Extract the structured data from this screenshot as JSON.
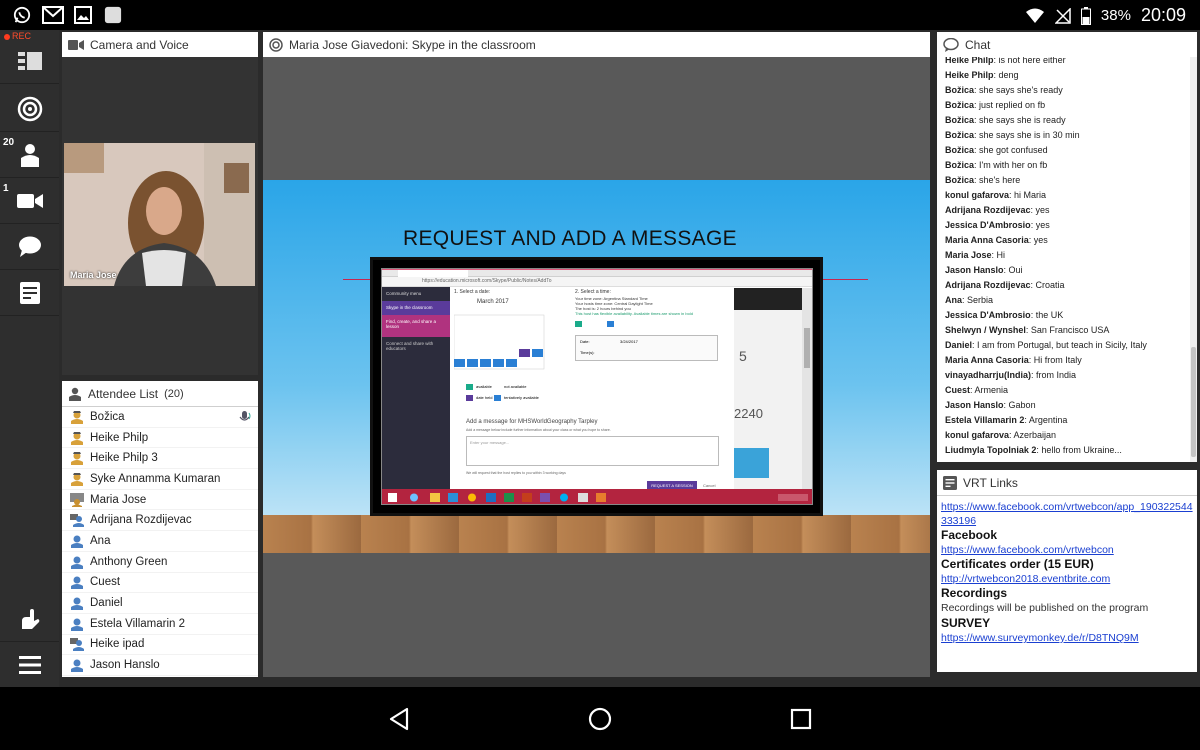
{
  "status_bar": {
    "battery_pct": "38%",
    "time": "20:09",
    "rec_label": "REC"
  },
  "rail": {
    "attendee_count": "20",
    "camera_count": "1"
  },
  "camera_panel": {
    "title": "Camera and Voice",
    "presenter_name": "Maria Jose"
  },
  "attendee_panel": {
    "title": "Attendee List",
    "count": "(20)",
    "attendees": [
      "Božica",
      "Heike  Philp",
      "Heike  Philp 3",
      "Syke Annamma Kumaran",
      "Maria Jose",
      "Adrijana Rozdijevac",
      "Ana",
      "Anthony Green",
      "Cuest",
      "Daniel",
      "Estela Villamarin 2",
      "Heike ipad",
      "Jason Hanslo"
    ]
  },
  "presentation": {
    "title": "Maria Jose Giavedoni: Skype in the classroom",
    "slide_title": "REQUEST AND ADD A MESSAGE",
    "screen": {
      "url": "https://education.microsoft.com/Skype/Public/Notes/AddTo",
      "nav_items": [
        "Community menu",
        "Skype in the classroom",
        "Find, create, and share a lesson",
        "Connect and share with educators"
      ],
      "month": "March 2017",
      "step1": "1. Select a date:",
      "step2": "2. Select a time:",
      "tz1": "Your time zone: Argentina Standard Time",
      "tz2": "Your hosts time zone: Central Daylight Time",
      "host_note": "The host is: 2 hours behind you",
      "avail_note": "This host has flexible availability. Available times are shown in bold",
      "legend_available": "available",
      "legend_not": "not available",
      "legend_tent": "tentatively available",
      "legend_booked": "date held",
      "date_label": "Date:",
      "date_value": "3/24/2017",
      "time_label": "Time(s):",
      "msg_heading": "Add a message for MHSWorldGeography Tarpley",
      "msg_sub": "Add a message below include further information about your class or what you hope to share.",
      "msg_placeholder": "Enter your message...",
      "reply_note": "We will request that the host replies to you within 3 working days",
      "request_btn": "REQUEST A SESSION",
      "cancel": "Cancel",
      "big_number": "5",
      "big_number2": "2240"
    }
  },
  "chat": {
    "title": "Chat",
    "messages": [
      {
        "user": "Heike Philp",
        "text": "is not here either"
      },
      {
        "user": "Heike Philp",
        "text": "deng"
      },
      {
        "user": "Božica",
        "text": "she says she's ready"
      },
      {
        "user": "Božica",
        "text": "just replied on fb"
      },
      {
        "user": "Božica",
        "text": "she says she is ready"
      },
      {
        "user": "Božica",
        "text": "she says she is in 30 min"
      },
      {
        "user": "Božica",
        "text": "she got confused"
      },
      {
        "user": "Božica",
        "text": "I'm with her on fb"
      },
      {
        "user": "Božica",
        "text": "she's here"
      },
      {
        "user": "konul gafarova",
        "text": "hi Maria"
      },
      {
        "user": "Adrijana Rozdijevac",
        "text": "yes"
      },
      {
        "user": "Jessica D'Ambrosio",
        "text": "yes"
      },
      {
        "user": "Maria Anna Casoria",
        "text": "yes"
      },
      {
        "user": "Maria Jose",
        "text": "Hi"
      },
      {
        "user": "Jason Hanslo",
        "text": "Oui"
      },
      {
        "user": "Adrijana Rozdijevac",
        "text": "Croatia"
      },
      {
        "user": "Ana",
        "text": "Serbia"
      },
      {
        "user": "Jessica D'Ambrosio",
        "text": "the UK"
      },
      {
        "user": "Shelwyn / Wynshel",
        "text": "San Francisco USA"
      },
      {
        "user": "Daniel",
        "text": "I am from Portugal, but teach in Sicily, Italy"
      },
      {
        "user": "Maria Anna Casoria",
        "text": "Hi from Italy"
      },
      {
        "user": "vinayadharrju(India)",
        "text": "from India"
      },
      {
        "user": "Cuest",
        "text": "Armenia"
      },
      {
        "user": "Jason Hanslo",
        "text": "Gabon"
      },
      {
        "user": "Estela Villamarin 2",
        "text": "Argentina"
      },
      {
        "user": "konul gafarova",
        "text": "Azerbaijan"
      },
      {
        "user": "Liudmyla Topolniak 2",
        "text": "hello from Ukraine..."
      }
    ]
  },
  "vrt_links": {
    "title": "VRT Links",
    "link1": "https://www.facebook.com/vrtwebcon/app_190322544333196",
    "heading_facebook": "Facebook",
    "link2": "https://www.facebook.com/vrtwebcon",
    "heading_certs": "Certificates order (15 EUR)",
    "link3": "http://vrtwebcon2018.eventbrite.com",
    "heading_recordings": "Recordings",
    "recordings_text": "Recordings will be published on the program",
    "heading_survey": "SURVEY",
    "link4": "https://www.surveymonkey.de/r/D8TNQ9M"
  },
  "colors": {
    "accent": "#1a3fd1",
    "rec": "#ff3b1f",
    "slide_sky": "#2aa5e8",
    "rail_bg": "#2e2e2e"
  }
}
